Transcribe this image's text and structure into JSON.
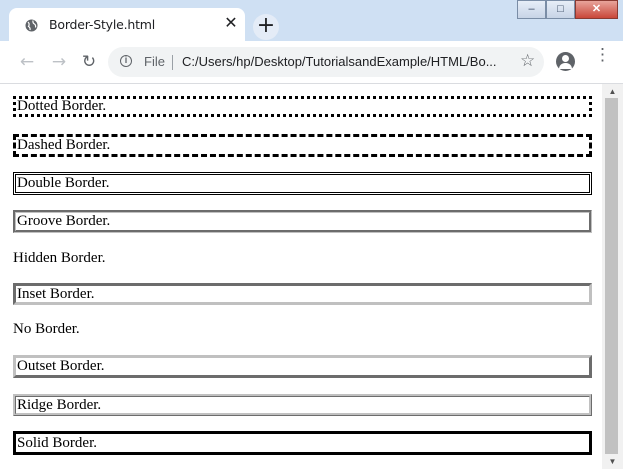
{
  "window": {
    "tab_title": "Border-Style.html",
    "tab_close_glyph": "✕",
    "new_tab_glyph": "+",
    "minimize_glyph": "‒",
    "maximize_glyph": "□",
    "close_glyph": "✕"
  },
  "toolbar": {
    "back_glyph": "←",
    "forward_glyph": "→",
    "reload_glyph": "↻",
    "scheme_label": "File",
    "url": "C:/Users/hp/Desktop/TutorialsandExample/HTML/Bo...",
    "star_glyph": "☆",
    "menu_glyph": "⋮"
  },
  "page": {
    "boxes": [
      {
        "label": "Dotted Border.",
        "style": "dotted"
      },
      {
        "label": "Dashed Border.",
        "style": "dashed"
      },
      {
        "label": "Double Border.",
        "style": "double"
      },
      {
        "label": "Groove Border.",
        "style": "groove"
      },
      {
        "label": "Hidden Border.",
        "style": "hidden"
      },
      {
        "label": "Inset Border.",
        "style": "inset"
      },
      {
        "label": "No Border.",
        "style": "none"
      },
      {
        "label": "Outset Border.",
        "style": "outset"
      },
      {
        "label": "Ridge Border.",
        "style": "ridge"
      },
      {
        "label": "Solid Border.",
        "style": "solid"
      }
    ]
  },
  "scrollbar": {
    "up_glyph": "▲",
    "down_glyph": "▼"
  },
  "colors": {
    "titlebar": "#cfe0f3",
    "omnibox": "#f1f3f4",
    "scroll_thumb": "#c1c1c1"
  },
  "icons": {
    "favicon": "globe-icon",
    "site_info": "info-icon",
    "profile": "account-circle-icon"
  }
}
